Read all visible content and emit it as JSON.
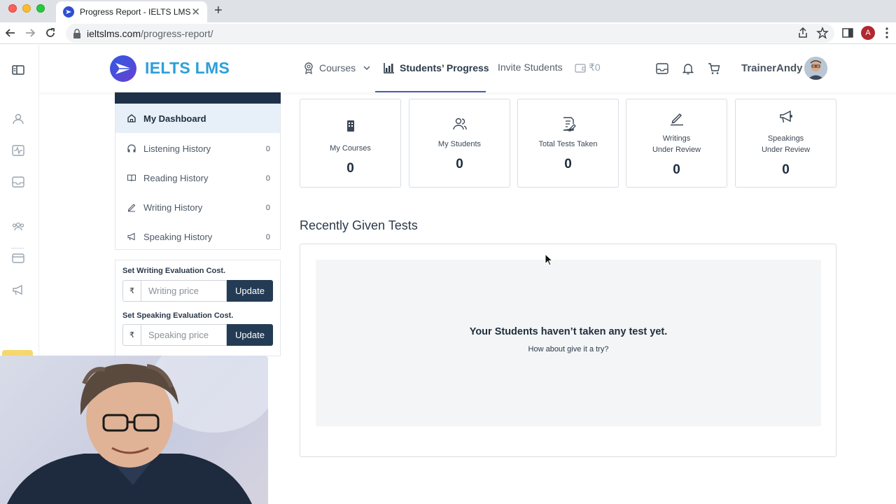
{
  "browser": {
    "tab_title": "Progress Report - IELTS LMS",
    "url_host": "ieltslms.com",
    "url_path": "/progress-report/",
    "profile_initial": "A"
  },
  "header": {
    "logo_text": "IELTS LMS",
    "menu": {
      "courses": "Courses",
      "progress": "Students’ Progress",
      "invite": "Invite Students",
      "wallet": "₹0"
    },
    "username": "TrainerAndy"
  },
  "sidebar": {
    "items": [
      {
        "label": "My Dashboard",
        "icon": "home-icon"
      },
      {
        "label": "Listening History",
        "count": "0",
        "icon": "headphones-icon"
      },
      {
        "label": "Reading History",
        "count": "0",
        "icon": "book-icon"
      },
      {
        "label": "Writing History",
        "count": "0",
        "icon": "pen-icon"
      },
      {
        "label": "Speaking History",
        "count": "0",
        "icon": "megaphone-icon"
      }
    ],
    "writing_cost_label": "Set Writing Evaluation Cost.",
    "writing_placeholder": "Writing price",
    "speaking_cost_label": "Set Speaking Evaluation Cost.",
    "speaking_placeholder": "Speaking price",
    "currency_symbol": "₹",
    "update_label": "Update"
  },
  "stats": [
    {
      "label": "My Courses",
      "value": "0",
      "icon": "building-icon"
    },
    {
      "label": "My Students",
      "value": "0",
      "icon": "users-icon"
    },
    {
      "label": "Total Tests Taken",
      "value": "0",
      "icon": "document-edit-icon"
    },
    {
      "label": "Writings\nUnder Review",
      "value": "0",
      "icon": "pen-icon"
    },
    {
      "label": "Speakings\nUnder Review",
      "value": "0",
      "icon": "megaphone-icon"
    }
  ],
  "recent": {
    "title": "Recently Given Tests",
    "empty_title": "Your Students haven’t taken any test yet.",
    "empty_subtitle": "How about give it a try?"
  },
  "colors": {
    "brand_blue": "#2d9fd8",
    "navy": "#243b55",
    "active_rail": "#f5d76e"
  }
}
